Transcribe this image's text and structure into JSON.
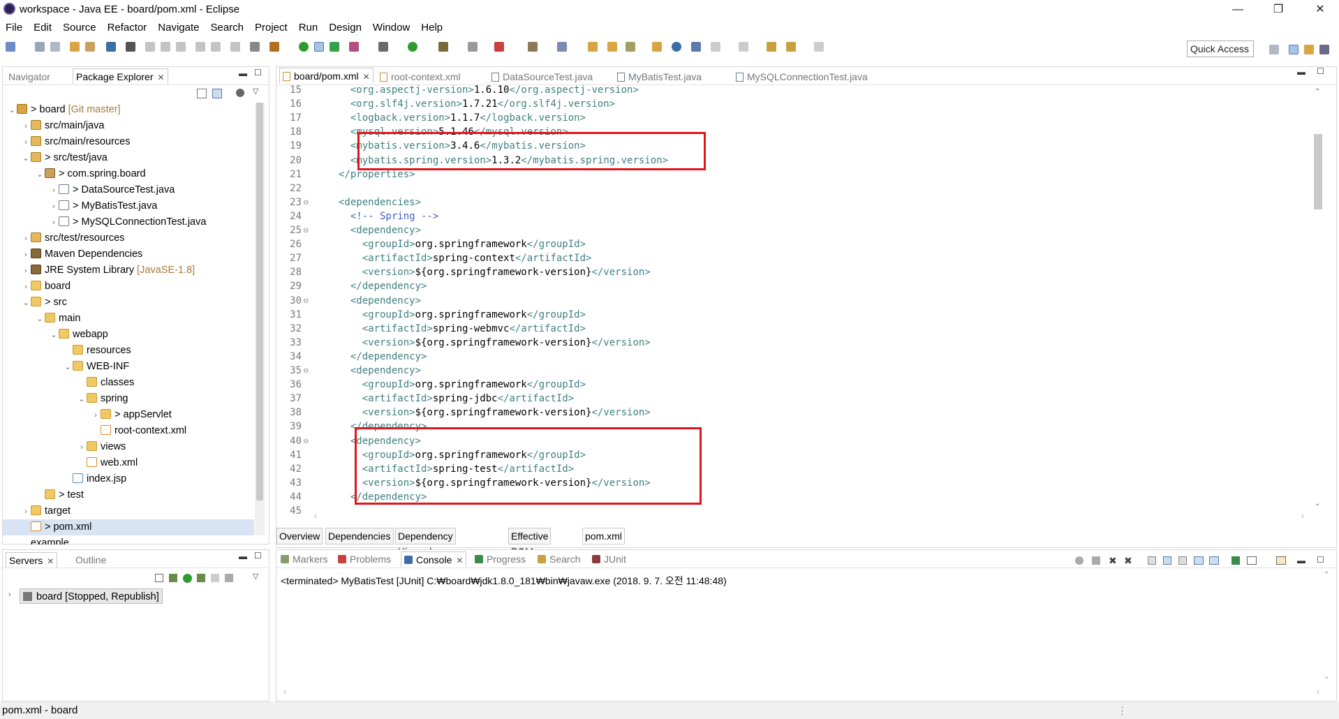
{
  "window": {
    "title": "workspace - Java EE - board/pom.xml - Eclipse",
    "minimize": "—",
    "maximize": "❐",
    "close": "✕"
  },
  "menu": [
    "File",
    "Edit",
    "Source",
    "Refactor",
    "Navigate",
    "Search",
    "Project",
    "Run",
    "Design",
    "Window",
    "Help"
  ],
  "quick_access": "Quick Access",
  "left_tabs": {
    "navigator": "Navigator",
    "package_explorer": "Package Explorer"
  },
  "tree": [
    {
      "indent": 0,
      "arrow": "⌄",
      "icon": "proj",
      "prefix": "> ",
      "label": "board",
      "deco": " [Git master]"
    },
    {
      "indent": 1,
      "arrow": "›",
      "icon": "pkgroot",
      "prefix": "",
      "label": "src/main/java",
      "deco": ""
    },
    {
      "indent": 1,
      "arrow": "›",
      "icon": "pkgroot",
      "prefix": "",
      "label": "src/main/resources",
      "deco": ""
    },
    {
      "indent": 1,
      "arrow": "⌄",
      "icon": "pkgroot",
      "prefix": "> ",
      "label": "src/test/java",
      "deco": ""
    },
    {
      "indent": 2,
      "arrow": "⌄",
      "icon": "pkg",
      "prefix": "> ",
      "label": "com.spring.board",
      "deco": ""
    },
    {
      "indent": 3,
      "arrow": "›",
      "icon": "java",
      "prefix": "> ",
      "label": "DataSourceTest.java",
      "deco": ""
    },
    {
      "indent": 3,
      "arrow": "›",
      "icon": "java",
      "prefix": "> ",
      "label": "MyBatisTest.java",
      "deco": ""
    },
    {
      "indent": 3,
      "arrow": "›",
      "icon": "java",
      "prefix": "> ",
      "label": "MySQLConnectionTest.java",
      "deco": ""
    },
    {
      "indent": 1,
      "arrow": "›",
      "icon": "pkgroot",
      "prefix": "",
      "label": "src/test/resources",
      "deco": ""
    },
    {
      "indent": 1,
      "arrow": "›",
      "icon": "lib",
      "prefix": "",
      "label": "Maven Dependencies",
      "deco": ""
    },
    {
      "indent": 1,
      "arrow": "›",
      "icon": "lib",
      "prefix": "",
      "label": "JRE System Library",
      "deco": " [JavaSE-1.8]"
    },
    {
      "indent": 1,
      "arrow": "›",
      "icon": "folder",
      "prefix": "",
      "label": "board",
      "deco": ""
    },
    {
      "indent": 1,
      "arrow": "⌄",
      "icon": "folder",
      "prefix": "> ",
      "label": "src",
      "deco": ""
    },
    {
      "indent": 2,
      "arrow": "⌄",
      "icon": "folder",
      "prefix": "",
      "label": "main",
      "deco": ""
    },
    {
      "indent": 3,
      "arrow": "⌄",
      "icon": "folder",
      "prefix": "",
      "label": "webapp",
      "deco": ""
    },
    {
      "indent": 4,
      "arrow": "",
      "icon": "folder",
      "prefix": "",
      "label": "resources",
      "deco": ""
    },
    {
      "indent": 4,
      "arrow": "⌄",
      "icon": "folder",
      "prefix": "",
      "label": "WEB-INF",
      "deco": ""
    },
    {
      "indent": 5,
      "arrow": "",
      "icon": "folder",
      "prefix": "",
      "label": "classes",
      "deco": ""
    },
    {
      "indent": 5,
      "arrow": "⌄",
      "icon": "folder",
      "prefix": "",
      "label": "spring",
      "deco": ""
    },
    {
      "indent": 6,
      "arrow": "›",
      "icon": "folder",
      "prefix": "> ",
      "label": "appServlet",
      "deco": ""
    },
    {
      "indent": 6,
      "arrow": "",
      "icon": "xml",
      "prefix": "",
      "label": "root-context.xml",
      "deco": ""
    },
    {
      "indent": 5,
      "arrow": "›",
      "icon": "folder",
      "prefix": "",
      "label": "views",
      "deco": ""
    },
    {
      "indent": 5,
      "arrow": "",
      "icon": "xml",
      "prefix": "",
      "label": "web.xml",
      "deco": ""
    },
    {
      "indent": 4,
      "arrow": "",
      "icon": "jsp",
      "prefix": "",
      "label": "index.jsp",
      "deco": ""
    },
    {
      "indent": 2,
      "arrow": "",
      "icon": "folder",
      "prefix": "> ",
      "label": "test",
      "deco": ""
    },
    {
      "indent": 1,
      "arrow": "›",
      "icon": "folder",
      "prefix": "",
      "label": "target",
      "deco": ""
    },
    {
      "indent": 1,
      "arrow": "",
      "icon": "xml",
      "prefix": "> ",
      "label": "pom.xml",
      "deco": "",
      "selected": true
    },
    {
      "indent": 1,
      "arrow": "",
      "icon": "",
      "prefix": "",
      "label": "example",
      "deco": ""
    }
  ],
  "editor_tabs": [
    "board/pom.xml",
    "root-context.xml",
    "DataSourceTest.java",
    "MyBatisTest.java",
    "MySQLConnectionTest.java"
  ],
  "code_lines": [
    {
      "n": "15",
      "fold": "",
      "seg": [
        [
          "  ",
          ""
        ],
        [
          "<org.aspectj-version>",
          "t"
        ],
        [
          "1.6.10",
          ""
        ],
        [
          "</org.aspectj-version>",
          "t"
        ]
      ]
    },
    {
      "n": "16",
      "fold": "",
      "seg": [
        [
          "  ",
          ""
        ],
        [
          "<org.slf4j.version>",
          "t"
        ],
        [
          "1.7.21",
          ""
        ],
        [
          "</org.slf4j.version>",
          "t"
        ]
      ]
    },
    {
      "n": "17",
      "fold": "",
      "seg": [
        [
          "  ",
          ""
        ],
        [
          "<logback.version>",
          "t"
        ],
        [
          "1.1.7",
          ""
        ],
        [
          "</logback.version>",
          "t"
        ]
      ]
    },
    {
      "n": "18",
      "fold": "",
      "seg": [
        [
          "  ",
          ""
        ],
        [
          "<mysql.version>",
          "t"
        ],
        [
          "5.1.46",
          ""
        ],
        [
          "</mysql.version>",
          "t"
        ]
      ]
    },
    {
      "n": "19",
      "fold": "",
      "seg": [
        [
          "  ",
          ""
        ],
        [
          "<mybatis.version>",
          "t"
        ],
        [
          "3.4.6",
          ""
        ],
        [
          "</mybatis.version>",
          "t"
        ]
      ]
    },
    {
      "n": "20",
      "fold": "",
      "seg": [
        [
          "  ",
          ""
        ],
        [
          "<mybatis.spring.version>",
          "t"
        ],
        [
          "1.3.2",
          ""
        ],
        [
          "</mybatis.spring.version>",
          "t"
        ]
      ]
    },
    {
      "n": "21",
      "fold": "",
      "seg": [
        [
          "",
          ""
        ],
        [
          "</properties>",
          "t"
        ]
      ]
    },
    {
      "n": "22",
      "fold": "",
      "seg": []
    },
    {
      "n": "23",
      "fold": "⊖",
      "seg": [
        [
          "",
          ""
        ],
        [
          "<dependencies>",
          "t"
        ]
      ]
    },
    {
      "n": "24",
      "fold": "",
      "seg": [
        [
          "  ",
          ""
        ],
        [
          "<!-- Spring -->",
          "c"
        ]
      ]
    },
    {
      "n": "25",
      "fold": "⊖",
      "seg": [
        [
          "  ",
          ""
        ],
        [
          "<dependency>",
          "t"
        ]
      ]
    },
    {
      "n": "26",
      "fold": "",
      "seg": [
        [
          "    ",
          ""
        ],
        [
          "<groupId>",
          "t"
        ],
        [
          "org.springframework",
          ""
        ],
        [
          "</groupId>",
          "t"
        ]
      ]
    },
    {
      "n": "27",
      "fold": "",
      "seg": [
        [
          "    ",
          ""
        ],
        [
          "<artifactId>",
          "t"
        ],
        [
          "spring-context",
          ""
        ],
        [
          "</artifactId>",
          "t"
        ]
      ]
    },
    {
      "n": "28",
      "fold": "",
      "seg": [
        [
          "    ",
          ""
        ],
        [
          "<version>",
          "t"
        ],
        [
          "${org.springframework-version}",
          ""
        ],
        [
          "</version>",
          "t"
        ]
      ]
    },
    {
      "n": "29",
      "fold": "",
      "seg": [
        [
          "  ",
          ""
        ],
        [
          "</dependency>",
          "t"
        ]
      ]
    },
    {
      "n": "30",
      "fold": "⊖",
      "seg": [
        [
          "  ",
          ""
        ],
        [
          "<dependency>",
          "t"
        ]
      ]
    },
    {
      "n": "31",
      "fold": "",
      "seg": [
        [
          "    ",
          ""
        ],
        [
          "<groupId>",
          "t"
        ],
        [
          "org.springframework",
          ""
        ],
        [
          "</groupId>",
          "t"
        ]
      ]
    },
    {
      "n": "32",
      "fold": "",
      "seg": [
        [
          "    ",
          ""
        ],
        [
          "<artifactId>",
          "t"
        ],
        [
          "spring-webmvc",
          ""
        ],
        [
          "</artifactId>",
          "t"
        ]
      ]
    },
    {
      "n": "33",
      "fold": "",
      "seg": [
        [
          "    ",
          ""
        ],
        [
          "<version>",
          "t"
        ],
        [
          "${org.springframework-version}",
          ""
        ],
        [
          "</version>",
          "t"
        ]
      ]
    },
    {
      "n": "34",
      "fold": "",
      "seg": [
        [
          "  ",
          ""
        ],
        [
          "</dependency>",
          "t"
        ]
      ]
    },
    {
      "n": "35",
      "fold": "⊖",
      "seg": [
        [
          "  ",
          ""
        ],
        [
          "<dependency>",
          "t"
        ]
      ]
    },
    {
      "n": "36",
      "fold": "",
      "seg": [
        [
          "    ",
          ""
        ],
        [
          "<groupId>",
          "t"
        ],
        [
          "org.springframework",
          ""
        ],
        [
          "</groupId>",
          "t"
        ]
      ]
    },
    {
      "n": "37",
      "fold": "",
      "seg": [
        [
          "    ",
          ""
        ],
        [
          "<artifactId>",
          "t"
        ],
        [
          "spring-jdbc",
          ""
        ],
        [
          "</artifactId>",
          "t"
        ]
      ]
    },
    {
      "n": "38",
      "fold": "",
      "seg": [
        [
          "    ",
          ""
        ],
        [
          "<version>",
          "t"
        ],
        [
          "${org.springframework-version}",
          ""
        ],
        [
          "</version>",
          "t"
        ]
      ]
    },
    {
      "n": "39",
      "fold": "",
      "seg": [
        [
          "  ",
          ""
        ],
        [
          "</dependency>",
          "t"
        ]
      ]
    },
    {
      "n": "40",
      "fold": "⊖",
      "seg": [
        [
          "  ",
          ""
        ],
        [
          "<dependency>",
          "t"
        ]
      ]
    },
    {
      "n": "41",
      "fold": "",
      "seg": [
        [
          "    ",
          ""
        ],
        [
          "<groupId>",
          "t"
        ],
        [
          "org.springframework",
          ""
        ],
        [
          "</groupId>",
          "t"
        ]
      ]
    },
    {
      "n": "42",
      "fold": "",
      "seg": [
        [
          "    ",
          ""
        ],
        [
          "<artifactId>",
          "t"
        ],
        [
          "spring-test",
          ""
        ],
        [
          "</artifactId>",
          "t"
        ]
      ]
    },
    {
      "n": "43",
      "fold": "",
      "seg": [
        [
          "    ",
          ""
        ],
        [
          "<version>",
          "t"
        ],
        [
          "${org.springframework-version}",
          ""
        ],
        [
          "</version>",
          "t"
        ]
      ]
    },
    {
      "n": "44",
      "fold": "",
      "seg": [
        [
          "  ",
          ""
        ],
        [
          "</dependency>",
          "t"
        ]
      ]
    },
    {
      "n": "45",
      "fold": "",
      "seg": []
    }
  ],
  "pom_tabs": [
    "Overview",
    "Dependencies",
    "Dependency Hierarchy",
    "Effective POM",
    "pom.xml"
  ],
  "servers_tabs": {
    "servers": "Servers",
    "outline": "Outline"
  },
  "server_item": "board  [Stopped, Republish]",
  "console_tabs": [
    "Markers",
    "Problems",
    "Console",
    "Progress",
    "Search",
    "JUnit"
  ],
  "console_text": "<terminated> MyBatisTest [JUnit] C:₩board₩jdk1.8.0_181₩bin₩javaw.exe (2018. 9. 7. 오전 11:48:48)",
  "status": "pom.xml - board",
  "colors": {
    "tag": "#3f7f7f",
    "comment": "#3f5fbf",
    "highlight": "#e0151b"
  }
}
